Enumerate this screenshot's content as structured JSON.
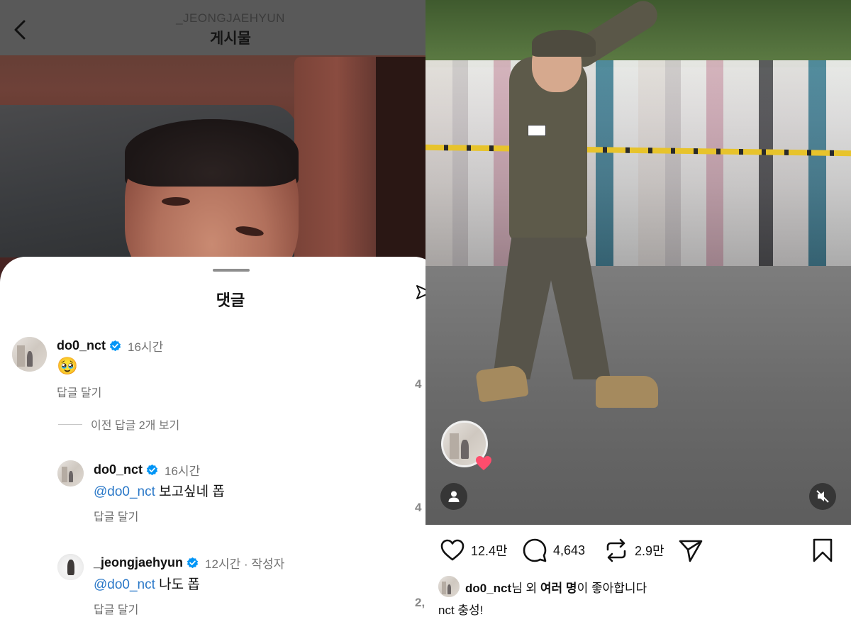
{
  "left": {
    "header": {
      "username": "_JEONGJAEHYUN",
      "title": "게시물"
    },
    "sheet": {
      "title": "댓글",
      "comments": [
        {
          "user": "do0_nct",
          "time": "16시간",
          "text": "🥹",
          "reply_label": "답글 달기"
        }
      ],
      "view_previous": "이전 답글 2개 보기",
      "replies": [
        {
          "user": "do0_nct",
          "time": "16시간",
          "mention": "@do0_nct",
          "text": " 보고싶네 폽",
          "reply_label": "답글 달기"
        },
        {
          "user": "_jeongjaehyun",
          "time": "12시간 · 작성자",
          "mention": "@do0_nct",
          "text": " 나도 폽",
          "reply_label": "답글 달기"
        }
      ],
      "edge_numbers": [
        "4",
        "4",
        "2,"
      ]
    }
  },
  "right": {
    "actions": {
      "likes": "12.4만",
      "comments": "4,643",
      "reposts": "2.9만"
    },
    "liked_by": {
      "user": "do0_nct",
      "suffix": "님 외 ",
      "others": "여러 명",
      "tail": "이 좋아합니다"
    },
    "caption": "nct 충성!"
  },
  "colors": {
    "mention": "#2a78c8",
    "verified": "#0095f6",
    "muted_text": "#737373",
    "heart_badge": "#ff4d6d"
  },
  "icons": [
    "back-icon",
    "send-icon",
    "verified-icon",
    "heart-icon",
    "comment-icon",
    "repost-icon",
    "share-icon",
    "bookmark-icon",
    "user-icon",
    "mute-icon"
  ]
}
